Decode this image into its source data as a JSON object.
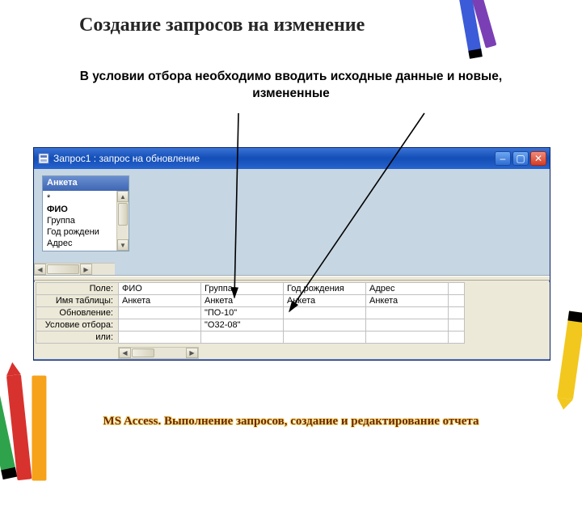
{
  "slide": {
    "title": "Создание запросов на изменение",
    "subtitle": "В условии отбора необходимо вводить исходные данные и новые, измененные",
    "footer": "MS Access. Выполнение запросов, создание и редактирование отчета"
  },
  "window": {
    "title": "Запрос1 : запрос на обновление",
    "table_name": "Анкета",
    "fields": [
      "*",
      "ФИО",
      "Группа",
      "Год рождени",
      "Адрес"
    ]
  },
  "grid": {
    "row_labels": [
      "Поле:",
      "Имя таблицы:",
      "Обновление:",
      "Условие отбора:",
      "или:"
    ],
    "columns": [
      {
        "field": "ФИО",
        "table": "Анкета",
        "update": "",
        "criteria": ""
      },
      {
        "field": "Группа",
        "table": "Анкета",
        "update": "\"ПО-10\"",
        "criteria": "\"О32-08\""
      },
      {
        "field": "Год рождения",
        "table": "Анкета",
        "update": "",
        "criteria": ""
      },
      {
        "field": "Адрес",
        "table": "Анкета",
        "update": "",
        "criteria": ""
      }
    ]
  },
  "icons": {
    "min": "–",
    "max": "▢",
    "close": "✕",
    "up": "▲",
    "down": "▼",
    "left": "◀",
    "right": "▶"
  },
  "crayons": {
    "blue": "#3b5bd8",
    "green": "#2fa34b",
    "red": "#d8322e",
    "orange": "#f6a21b",
    "purple": "#7a3fb5",
    "yellow": "#f2c81f"
  }
}
